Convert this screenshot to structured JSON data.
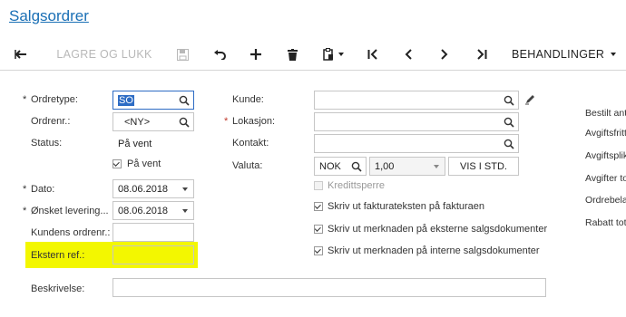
{
  "page": {
    "title": "Salgsordrer"
  },
  "toolbar": {
    "back_icon": "arrow-left-icon",
    "save_close_label": "LAGRE OG LUKK",
    "save_icon": "floppy-disk-icon",
    "undo_icon": "undo-icon",
    "add_icon": "plus-icon",
    "delete_icon": "trash-icon",
    "paste_icon": "clipboard-icon",
    "first_icon": "first-record-icon",
    "prev_icon": "chevron-left-icon",
    "next_icon": "chevron-right-icon",
    "last_icon": "last-record-icon",
    "actions_label": "BEHANDLINGER"
  },
  "form": {
    "ordretype": {
      "label": "Ordretype:",
      "value": "SO"
    },
    "ordrenr": {
      "label": "Ordrenr.:",
      "value": "<NY>"
    },
    "status": {
      "label": "Status:",
      "value": "På vent"
    },
    "pa_vent": {
      "label": "På vent",
      "checked": true
    },
    "dato": {
      "label": "Dato:",
      "value": "08.06.2018"
    },
    "onsket": {
      "label": "Ønsket levering...",
      "value": "08.06.2018"
    },
    "kundens_ordrenr": {
      "label": "Kundens ordrenr.:",
      "value": ""
    },
    "ekstern_ref": {
      "label": "Ekstern ref.:",
      "value": ""
    },
    "beskrivelse": {
      "label": "Beskrivelse:",
      "value": ""
    },
    "kunde": {
      "label": "Kunde:",
      "value": ""
    },
    "lokasjon": {
      "label": "Lokasjon:",
      "value": ""
    },
    "kontakt": {
      "label": "Kontakt:",
      "value": ""
    },
    "valuta": {
      "label": "Valuta:",
      "currency": "NOK",
      "rate": "1,00",
      "button": "VIS I STD."
    },
    "kreditsperre": {
      "label": "Kredittsperre",
      "checked": false
    },
    "skriv_faktura": {
      "label": "Skriv ut fakturateksten på fakturaen",
      "checked": true
    },
    "skriv_eksterne": {
      "label": "Skriv ut merknaden på eksterne salgsdokumenter",
      "checked": true
    },
    "skriv_interne": {
      "label": "Skriv ut merknaden på interne salgsdokumenter",
      "checked": true
    }
  },
  "summary": {
    "labels": [
      "Bestilt ant",
      "Avgiftsfritt",
      "Avgiftsplik",
      "Avgifter to",
      "Ordrebela",
      "Rabatt tot"
    ]
  },
  "colors": {
    "link": "#1a6fb5",
    "highlight": "#f3f700",
    "selection": "#2d6cc4"
  }
}
